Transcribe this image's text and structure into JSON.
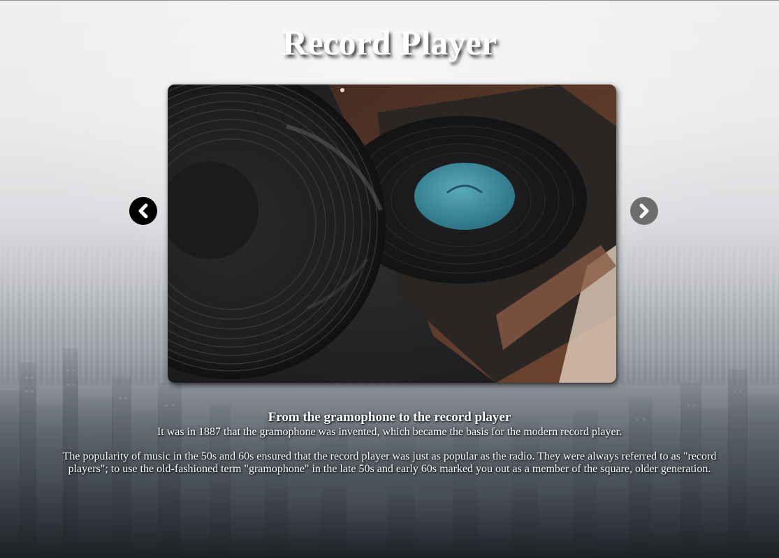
{
  "page": {
    "title": "Record Player"
  },
  "slider": {
    "image_alt": "vinyl-record-on-turntable",
    "prev_icon": "chevron-left-icon",
    "next_icon": "chevron-right-icon"
  },
  "caption": {
    "heading": "From the gramophone to the record player",
    "line1": "It was in 1887 that the gramophone was invented, which became the basis for the modern record player.",
    "paragraph": "The popularity of music in the 50s and 60s ensured that the record player was just as popular as the radio. They were always referred to as \"record players\"; to use the old-fashioned term \"gramophone\" in the late 50s and early 60s marked you out as a member of the square, older generation."
  },
  "colors": {
    "prev_button": "#000000",
    "next_button": "#6d6d6d",
    "label_teal": "#3a8fa3"
  }
}
